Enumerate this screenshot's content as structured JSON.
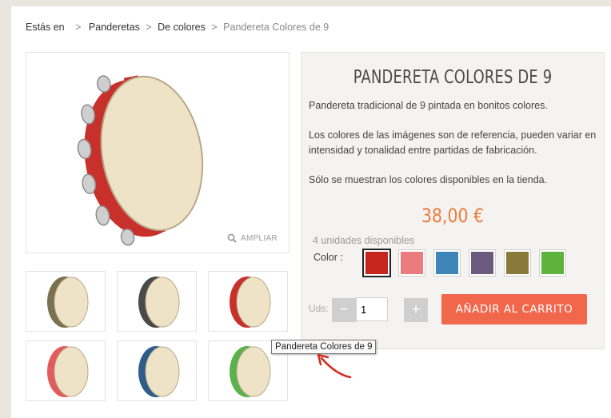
{
  "breadcrumb": {
    "home": "Estás en",
    "sep": ">",
    "level1": "Panderetas",
    "level2": "De colores",
    "current": "Pandereta Colores de 9"
  },
  "gallery": {
    "zoom_label": "AMPLIAR",
    "main_color": "#c8302b",
    "thumb_colors": [
      "#7a7150",
      "#4a4a4a",
      "#c8302b",
      "#e35c5c",
      "#2f5d8a",
      "#5ab34a"
    ]
  },
  "product": {
    "title": "PANDERETA COLORES DE 9",
    "description": [
      "Pandereta tradicional de 9 pintada en bonitos colores.",
      "Los colores de las imágenes son de referencia, pueden variar en intensidad y tonalidad entre partidas de fabricación.",
      "Sólo se muestran los colores disponibles en la tienda."
    ],
    "price": "38,00 €",
    "stock": "4 unidades disponibles",
    "color_label": "Color :",
    "colors": [
      "#c6241d",
      "#ea7b7f",
      "#3f86b8",
      "#6b5a7c",
      "#8a7a3a",
      "#5db33b"
    ],
    "selected_color": 0,
    "qty_label": "Uds:",
    "qty_minus": "−",
    "qty_plus": "+",
    "qty_value": "1",
    "add_to_cart": "AÑADIR AL CARRITO"
  },
  "tooltip": "Pandereta Colores de 9"
}
